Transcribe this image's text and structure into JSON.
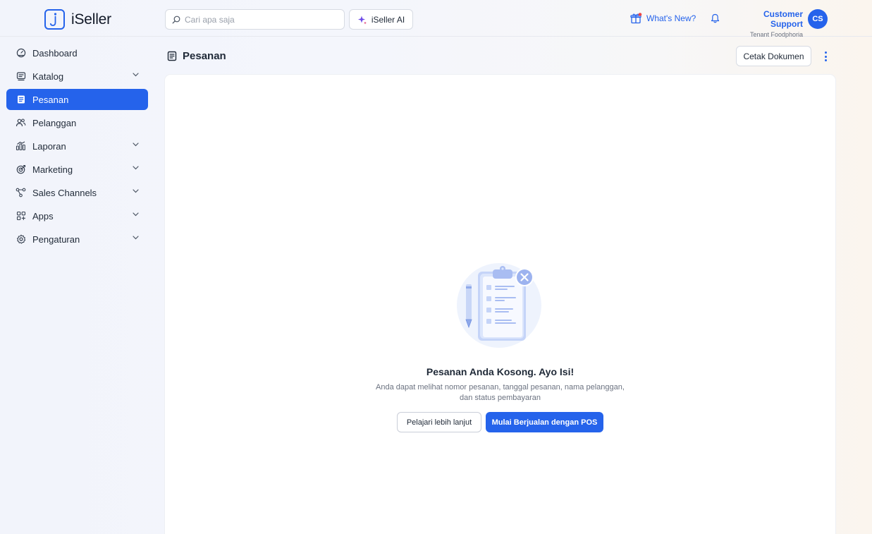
{
  "brand": {
    "name": "iSeller",
    "accent": "#2563eb"
  },
  "header": {
    "search_placeholder": "Cari apa saja",
    "ai_button": "iSeller AI",
    "whats_new": "What's New?",
    "user_name": "Customer Support",
    "user_tenant": "Tenant Foodphoria",
    "avatar_initials": "CS"
  },
  "sidebar": {
    "items": [
      {
        "label": "Dashboard",
        "icon": "dashboard-icon",
        "expandable": false
      },
      {
        "label": "Katalog",
        "icon": "catalog-icon",
        "expandable": true
      },
      {
        "label": "Pesanan",
        "icon": "orders-icon",
        "expandable": false,
        "active": true
      },
      {
        "label": "Pelanggan",
        "icon": "customers-icon",
        "expandable": false
      },
      {
        "label": "Laporan",
        "icon": "reports-icon",
        "expandable": true
      },
      {
        "label": "Marketing",
        "icon": "marketing-icon",
        "expandable": true
      },
      {
        "label": "Sales Channels",
        "icon": "sales-channels-icon",
        "expandable": true
      },
      {
        "label": "Apps",
        "icon": "apps-icon",
        "expandable": true
      },
      {
        "label": "Pengaturan",
        "icon": "settings-icon",
        "expandable": true
      }
    ]
  },
  "page": {
    "title": "Pesanan",
    "print_button": "Cetak Dokumen"
  },
  "empty_state": {
    "title": "Pesanan Anda Kosong. Ayo Isi!",
    "description": "Anda dapat melihat nomor pesanan, tanggal pesanan, nama pelanggan, dan status pembayaran",
    "learn_button": "Pelajari lebih lanjut",
    "pos_button": "Mulai Berjualan dengan POS"
  }
}
